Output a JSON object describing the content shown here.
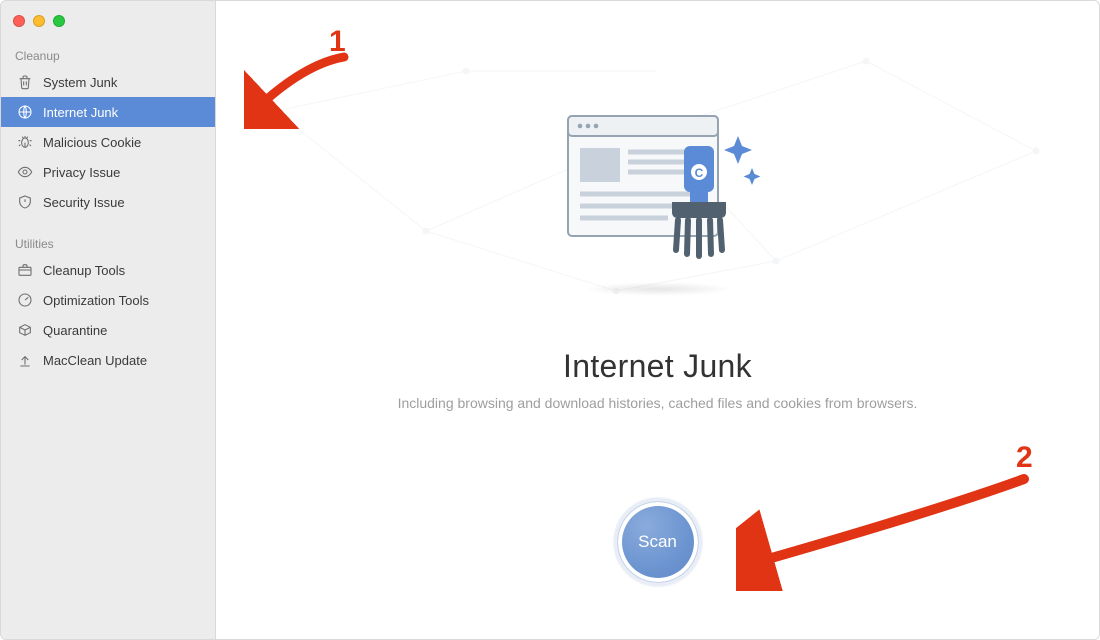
{
  "sidebar": {
    "sections": [
      {
        "header": "Cleanup",
        "items": [
          {
            "label": "System Junk",
            "icon": "trash-icon",
            "active": false
          },
          {
            "label": "Internet Junk",
            "icon": "globe-icon",
            "active": true
          },
          {
            "label": "Malicious Cookie",
            "icon": "bug-icon",
            "active": false
          },
          {
            "label": "Privacy Issue",
            "icon": "eye-icon",
            "active": false
          },
          {
            "label": "Security Issue",
            "icon": "shield-icon",
            "active": false
          }
        ]
      },
      {
        "header": "Utilities",
        "items": [
          {
            "label": "Cleanup Tools",
            "icon": "toolbox-icon",
            "active": false
          },
          {
            "label": "Optimization Tools",
            "icon": "gauge-icon",
            "active": false
          },
          {
            "label": "Quarantine",
            "icon": "box-icon",
            "active": false
          },
          {
            "label": "MacClean Update",
            "icon": "upload-icon",
            "active": false
          }
        ]
      }
    ]
  },
  "main": {
    "title": "Internet Junk",
    "description": "Including browsing and download histories, cached files and cookies from browsers.",
    "scan_label": "Scan"
  },
  "annotations": {
    "step1": "1",
    "step2": "2"
  },
  "colors": {
    "accent": "#5b8bd6",
    "annotation": "#e13415"
  }
}
